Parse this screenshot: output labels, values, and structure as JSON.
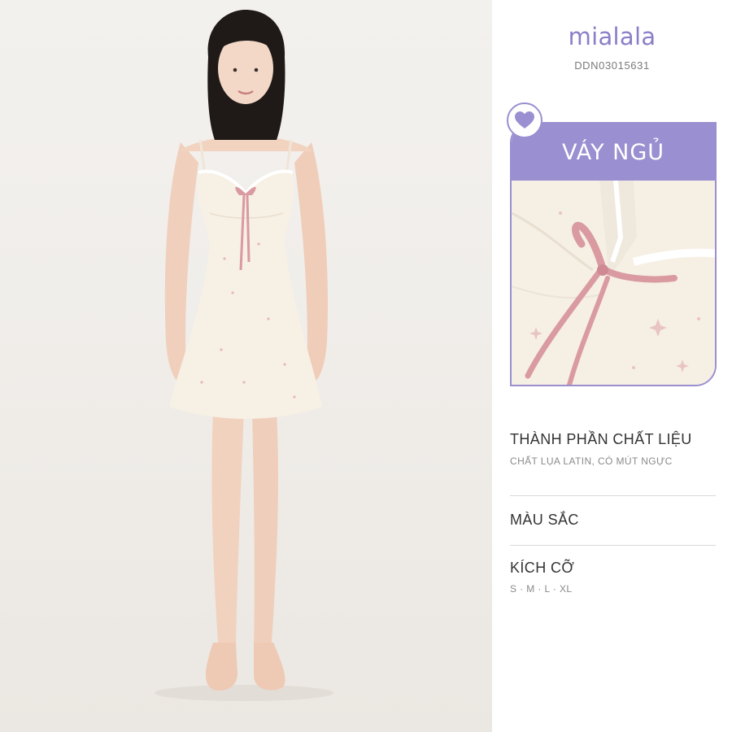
{
  "brand": {
    "name": "mialala",
    "sku": "DDN03015631"
  },
  "card": {
    "title": "VÁY NGỦ",
    "badge_icon": "heart-icon",
    "accent": "#9a8fd0"
  },
  "sections": {
    "material": {
      "title": "THÀNH PHẦN CHẤT LIỆU",
      "value": "CHẤT LỤA LATIN, CÓ MÚT NGỰC"
    },
    "color": {
      "title": "MÀU SẮC"
    },
    "size": {
      "title": "KÍCH CỠ",
      "value": "S · M · L · XL"
    }
  },
  "colors": {
    "brand": "#8b7ec8",
    "ribbon": "#d99aa0",
    "fabric": "#f7f0e4"
  }
}
